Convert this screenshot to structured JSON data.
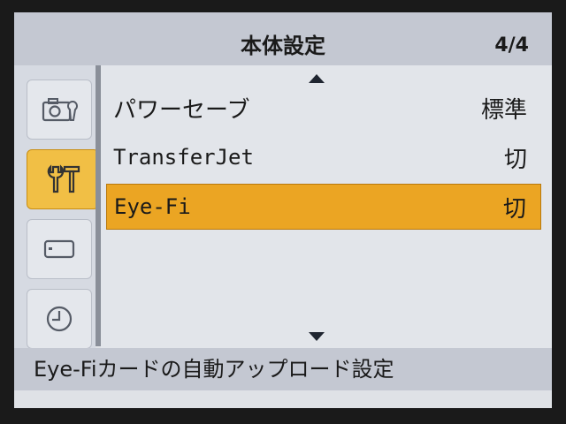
{
  "header": {
    "title": "本体設定",
    "page": "4/4"
  },
  "sidebar": {
    "tabs": [
      {
        "icon": "camera-settings-icon",
        "active": false
      },
      {
        "icon": "wrench-screwdriver-icon",
        "active": true
      },
      {
        "icon": "memory-card-icon",
        "active": false
      },
      {
        "icon": "clock-icon",
        "active": false
      }
    ]
  },
  "menu": {
    "items": [
      {
        "label": "パワーセーブ",
        "value": "標準",
        "selected": false
      },
      {
        "label": "TransferJet",
        "value": "切",
        "selected": false
      },
      {
        "label": "Eye-Fi",
        "value": "切",
        "selected": true
      }
    ]
  },
  "help_text": "Eye-Fiカードの自動アップロード設定",
  "colors": {
    "highlight": "#eba523",
    "active_tab": "#f1bf45",
    "header_bg": "#c4c8d2"
  }
}
